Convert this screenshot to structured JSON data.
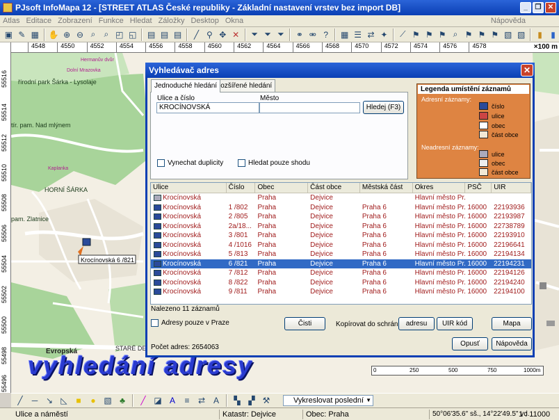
{
  "app": {
    "title": "PJsoft InfoMapa 12 - [STREET ATLAS České republiky - Základní nastavení vrstev bez import DB]"
  },
  "menu": {
    "items": [
      "Atlas",
      "Editace",
      "Zobrazení",
      "Funkce",
      "Hledat",
      "Záložky",
      "Desktop",
      "Okna"
    ],
    "help": "Nápověda"
  },
  "ruler": {
    "top": [
      "4548",
      "4550",
      "4552",
      "4554",
      "4556",
      "4558",
      "4560",
      "4562",
      "4564",
      "4566",
      "4568",
      "4570",
      "4572",
      "4574",
      "4576",
      "4578"
    ],
    "unit": "×100 m",
    "left": [
      "55516",
      "55514",
      "55512",
      "55510",
      "55508",
      "55506",
      "55504",
      "55502",
      "55500",
      "55498",
      "55496"
    ]
  },
  "map_labels": {
    "park1": "řírodní park Šárka - Lysolaje",
    "park2": "tír. pam. Nad mlýnem",
    "hs": "HORNÍ ŠÁRKA",
    "kaplanka": "Kaplanka",
    "zlatnice": "pam. Zlatnice",
    "marker": "Krocínovská 6 /821",
    "evropska": "Evropská",
    "stare": "STARÉ DE",
    "mrazovka": "Dolní Mrazovka",
    "dvur": "Hermanův dvůr"
  },
  "overlay": {
    "caption": "vyhledání adresy"
  },
  "dialog": {
    "title": "Vyhledávač adres",
    "tabs": [
      "Jednoduché hledání",
      "Rozšířené hledání"
    ],
    "street_label": "Ulice a číslo",
    "street_value": "KROCÍNOVSKÁ",
    "city_label": "Město",
    "city_value": "",
    "search_button": "Hledej (F3)",
    "chk_dup": "Vynechat duplicity",
    "chk_match": "Hledat pouze shodu",
    "legend": {
      "title": "Legenda umístění záznamů",
      "addr_head": "Adresní záznamy:",
      "addr_items": [
        "číslo",
        "ulice",
        "obec",
        "část obce"
      ],
      "nonaddr_head": "Neadresní záznamy:",
      "nonaddr_items": [
        "ulice",
        "obec",
        "část obce"
      ]
    },
    "columns": [
      "Ulice",
      "Číslo",
      "Obec",
      "Část obce",
      "Městská část",
      "Okres",
      "PSČ",
      "UIR"
    ],
    "rows": [
      {
        "ulice": "Krocínovská",
        "cislo": "",
        "obec": "Praha",
        "cast": "Dejvice",
        "mc": "",
        "okres": "Hlavní město Pr...",
        "psc": "",
        "uir": "",
        "type": "u"
      },
      {
        "ulice": "Krocínovská",
        "cislo": "1 /802",
        "obec": "Praha",
        "cast": "Dejvice",
        "mc": "Praha 6",
        "okres": "Hlavní město Pr...",
        "psc": "16000",
        "uir": "22193936",
        "type": "n"
      },
      {
        "ulice": "Krocínovská",
        "cislo": "2 /805",
        "obec": "Praha",
        "cast": "Dejvice",
        "mc": "Praha 6",
        "okres": "Hlavní město Pr...",
        "psc": "16000",
        "uir": "22193987",
        "type": "n"
      },
      {
        "ulice": "Krocínovská",
        "cislo": "2a/18...",
        "obec": "Praha",
        "cast": "Dejvice",
        "mc": "Praha 6",
        "okres": "Hlavní město Pr...",
        "psc": "16000",
        "uir": "22738789",
        "type": "n"
      },
      {
        "ulice": "Krocínovská",
        "cislo": "3 /801",
        "obec": "Praha",
        "cast": "Dejvice",
        "mc": "Praha 6",
        "okres": "Hlavní město Pr...",
        "psc": "16000",
        "uir": "22193910",
        "type": "n"
      },
      {
        "ulice": "Krocínovská",
        "cislo": "4 /1016",
        "obec": "Praha",
        "cast": "Dejvice",
        "mc": "Praha 6",
        "okres": "Hlavní město Pr...",
        "psc": "16000",
        "uir": "22196641",
        "type": "n"
      },
      {
        "ulice": "Krocínovská",
        "cislo": "5 /813",
        "obec": "Praha",
        "cast": "Dejvice",
        "mc": "Praha 6",
        "okres": "Hlavní město Pr...",
        "psc": "16000",
        "uir": "22194134",
        "type": "n"
      },
      {
        "ulice": "Krocínovská",
        "cislo": "6 /821",
        "obec": "Praha",
        "cast": "Dejvice",
        "mc": "Praha 6",
        "okres": "Hlavní město Pr...",
        "psc": "16000",
        "uir": "22194231",
        "type": "n",
        "selected": true
      },
      {
        "ulice": "Krocínovská",
        "cislo": "7 /812",
        "obec": "Praha",
        "cast": "Dejvice",
        "mc": "Praha 6",
        "okres": "Hlavní město Pr...",
        "psc": "16000",
        "uir": "22194126",
        "type": "n"
      },
      {
        "ulice": "Krocínovská",
        "cislo": "8 /822",
        "obec": "Praha",
        "cast": "Dejvice",
        "mc": "Praha 6",
        "okres": "Hlavní město Pr...",
        "psc": "16000",
        "uir": "22194240",
        "type": "n"
      },
      {
        "ulice": "Krocínovská",
        "cislo": "9 /811",
        "obec": "Praha",
        "cast": "Dejvice",
        "mc": "Praha 6",
        "okres": "Hlavní město Pr...",
        "psc": "16000",
        "uir": "22194100",
        "type": "n"
      }
    ],
    "found": "Nalezeno 11 záznamů",
    "chk_prague": "Adresy pouze v Praze",
    "clear_button": "Čisti",
    "copy_label": "Kopírovat do schránky:",
    "copy_addr_button": "adresu",
    "copy_uir_button": "UIR kód",
    "map_button": "Mapa",
    "count": "Počet adres: 2654063",
    "close_button": "Opusť",
    "help_button": "Nápověda"
  },
  "scale": {
    "labels": [
      "0",
      "250",
      "500",
      "750",
      "1000m"
    ]
  },
  "toolbar2": {
    "draw_select": "Vykreslovat poslední"
  },
  "status": {
    "layer": "Ulice a náměstí",
    "cadastre": "Katastr: Dejvice",
    "city": "Obec: Praha",
    "coords": "50°06'35.6\" sš., 14°22'49.5\" vd.",
    "scale": "1 : 11000"
  },
  "colors": {
    "title_blue": "#0a3fb4",
    "legend_orange": "#de8442",
    "selection": "#316ac5",
    "row_text": "#a01c1c",
    "caption": "#2a3bd0"
  }
}
